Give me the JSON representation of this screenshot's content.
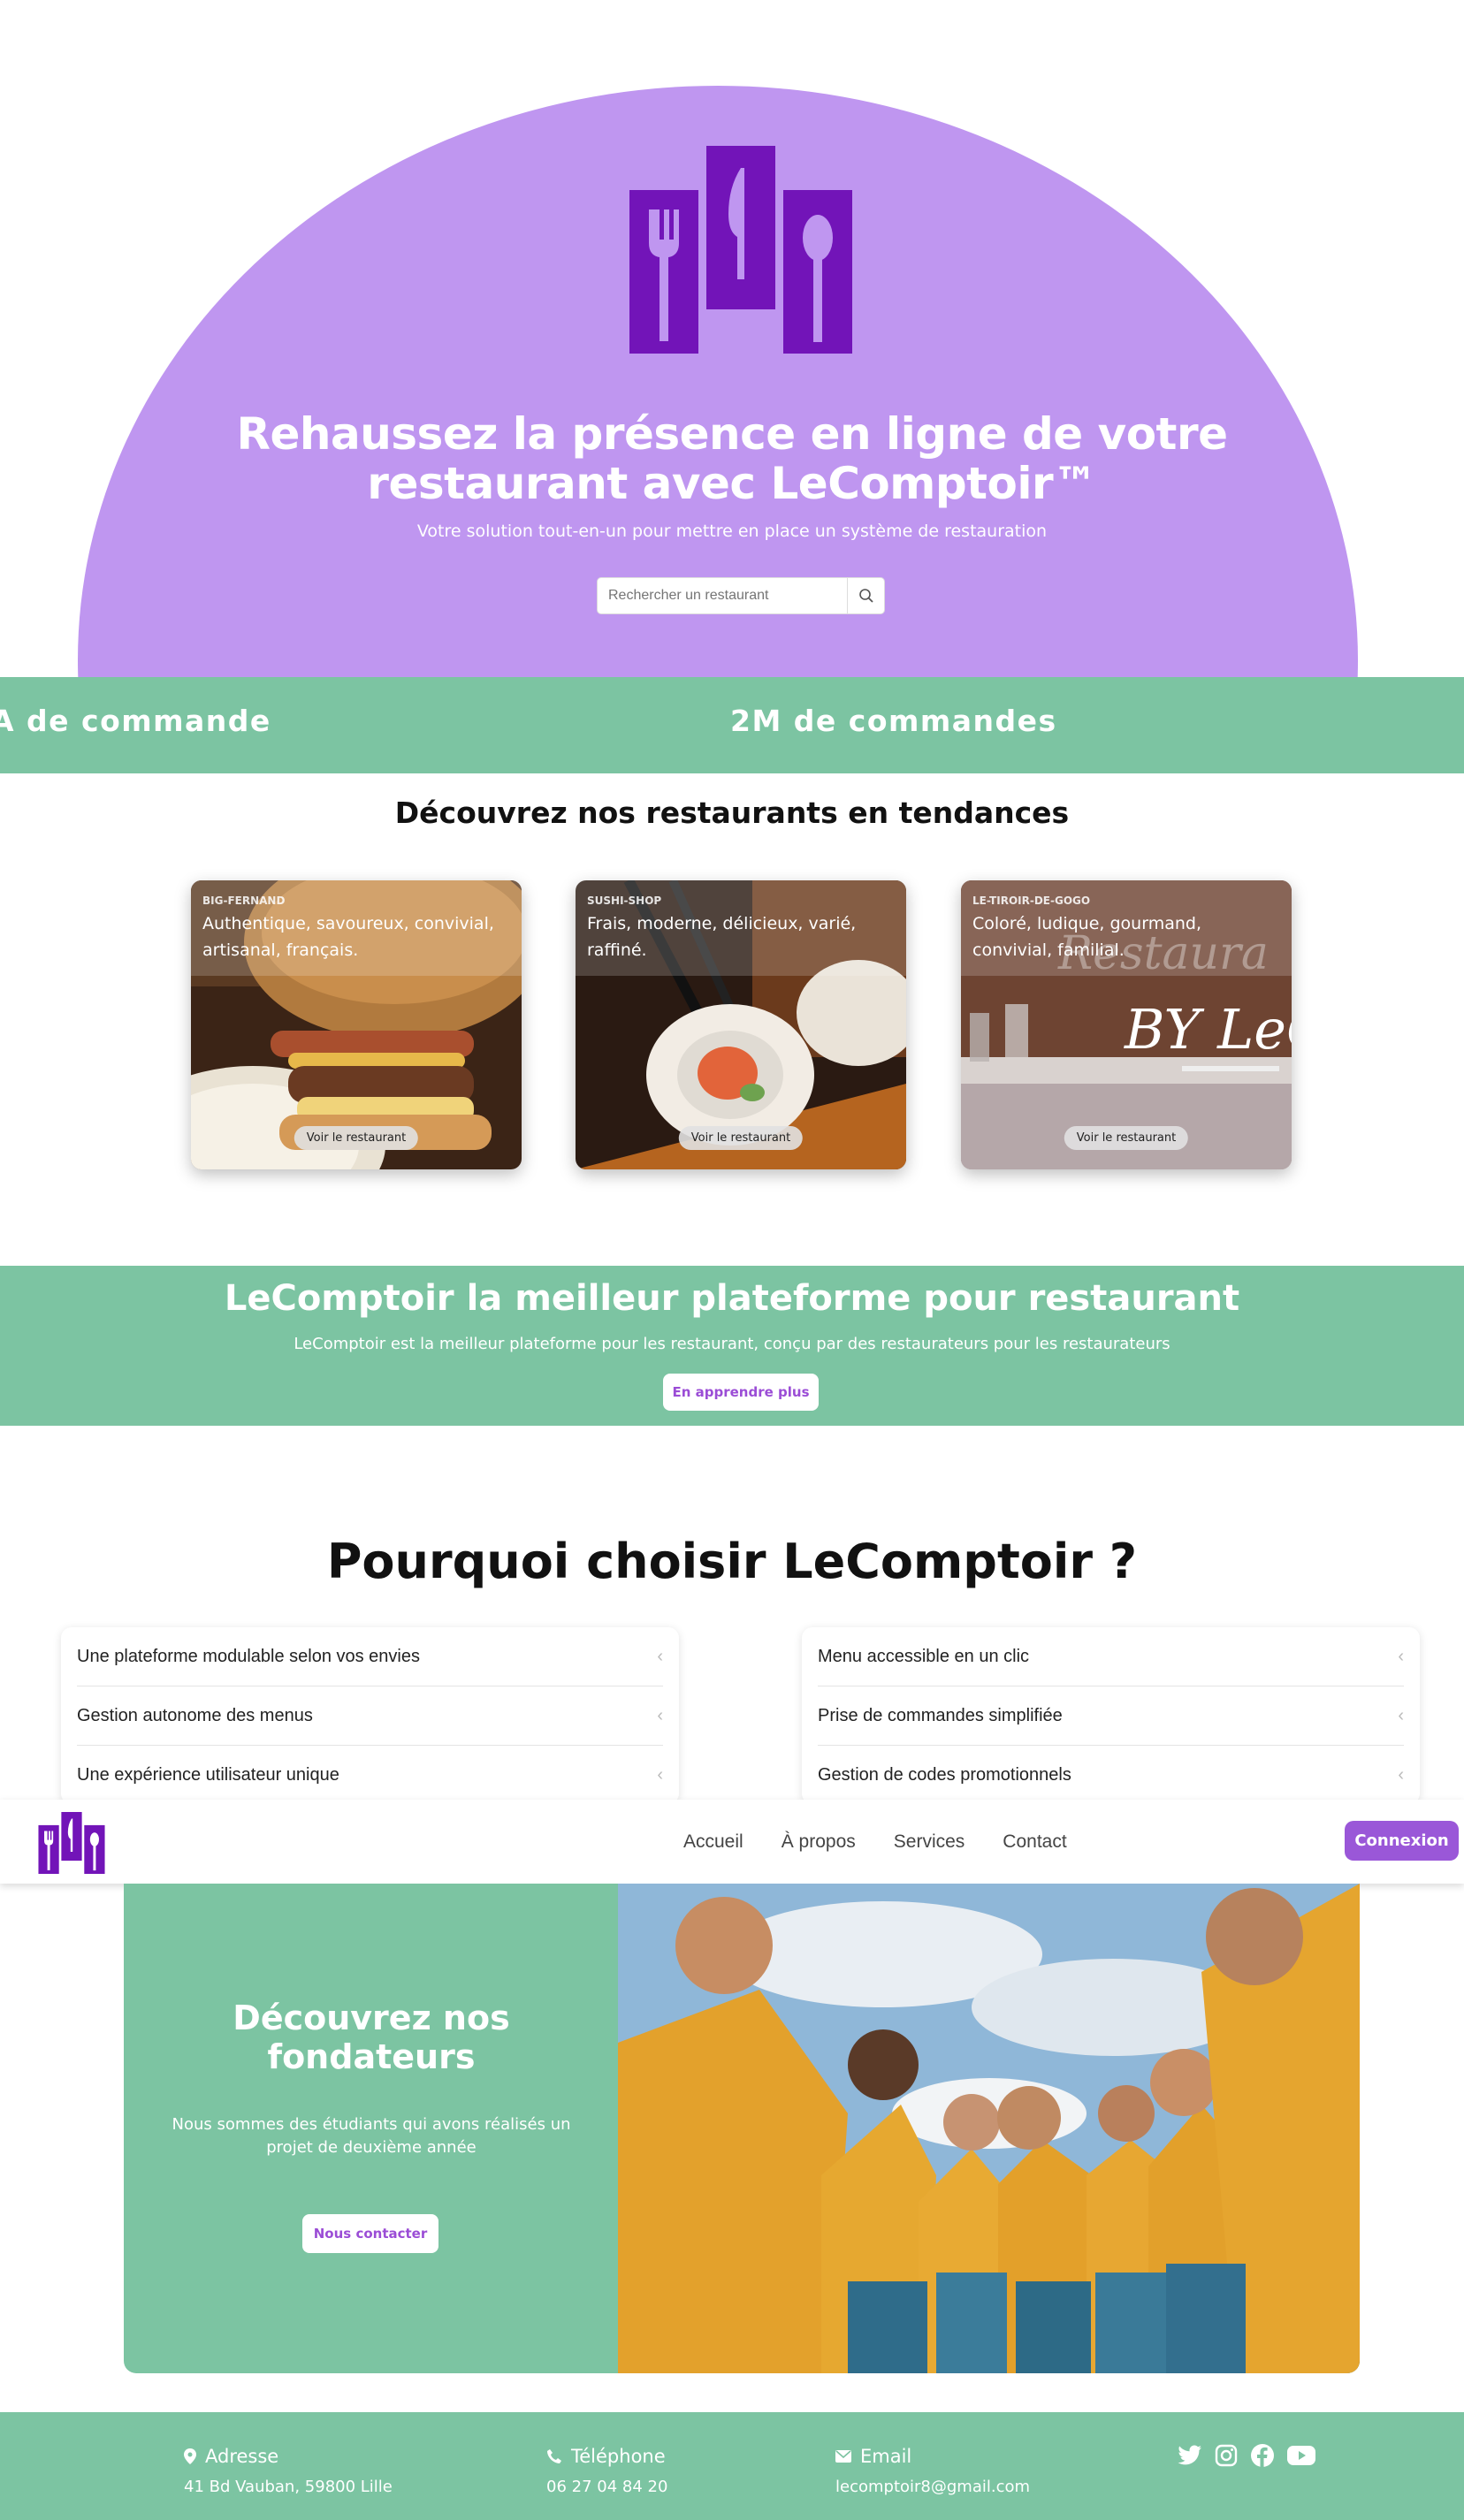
{
  "hero": {
    "title": "Rehaussez la présence en ligne de votre restaurant avec LeComptoir™",
    "subtitle": "Votre solution tout-en-un pour mettre en place un système de restauration",
    "search_placeholder": "Rechercher un restaurant",
    "logo_icon": "cutlery-logo-icon",
    "colors": {
      "arch": "#bf96f0",
      "logo": "#7214b8"
    }
  },
  "band": {
    "items": [
      "A de commande",
      "2M de commandes"
    ]
  },
  "trending": {
    "title": "Découvrez nos restaurants en tendances",
    "cards": [
      {
        "slug": "BIG-FERNAND",
        "description": "Authentique, savoureux, convivial, artisanal, français.",
        "button": "Voir le restaurant"
      },
      {
        "slug": "SUSHI-SHOP",
        "description": "Frais, moderne, délicieux, varié, raffiné.",
        "button": "Voir le restaurant"
      },
      {
        "slug": "LE-TIROIR-DE-GOGO",
        "description": "Coloré, ludique, gourmand, convivial, familial.",
        "button": "Voir le restaurant",
        "photo_text_1": "Restaura",
        "photo_text_2": "BY LeC"
      }
    ]
  },
  "platform": {
    "title": "LeComptoir la meilleur plateforme pour restaurant",
    "text": "LeComptoir est la meilleur plateforme pour les restaurant, conçu par des restaurateurs pour les restaurateurs",
    "button": "En apprendre plus"
  },
  "why": {
    "title": "Pourquoi choisir LeComptoir ?",
    "left": [
      "Une plateforme modulable selon vos envies",
      "Gestion autonome des menus",
      "Une expérience utilisateur unique"
    ],
    "right": [
      "Menu accessible en un clic",
      "Prise de commandes simplifiée",
      "Gestion de codes promotionnels"
    ],
    "chevron": "‹"
  },
  "nav": {
    "links": [
      "Accueil",
      "À propos",
      "Services",
      "Contact"
    ],
    "login": "Connexion"
  },
  "founders": {
    "title": "Découvrez nos fondateurs",
    "text": "Nous sommes des étudiants qui avons réalisés un projet de deuxième année",
    "button": "Nous contacter"
  },
  "footer": {
    "address_label": "Adresse",
    "address": "41 Bd Vauban, 59800 Lille",
    "phone_label": "Téléphone",
    "phone": "06 27 04 84 20",
    "email_label": "Email",
    "email": "lecomptoir8@gmail.com",
    "socials": [
      "twitter-icon",
      "instagram-icon",
      "facebook-icon",
      "youtube-icon"
    ]
  },
  "colors": {
    "green": "#7cc4a2",
    "purple_button": "#9a57d8",
    "purple_text": "#9b4dd6"
  }
}
